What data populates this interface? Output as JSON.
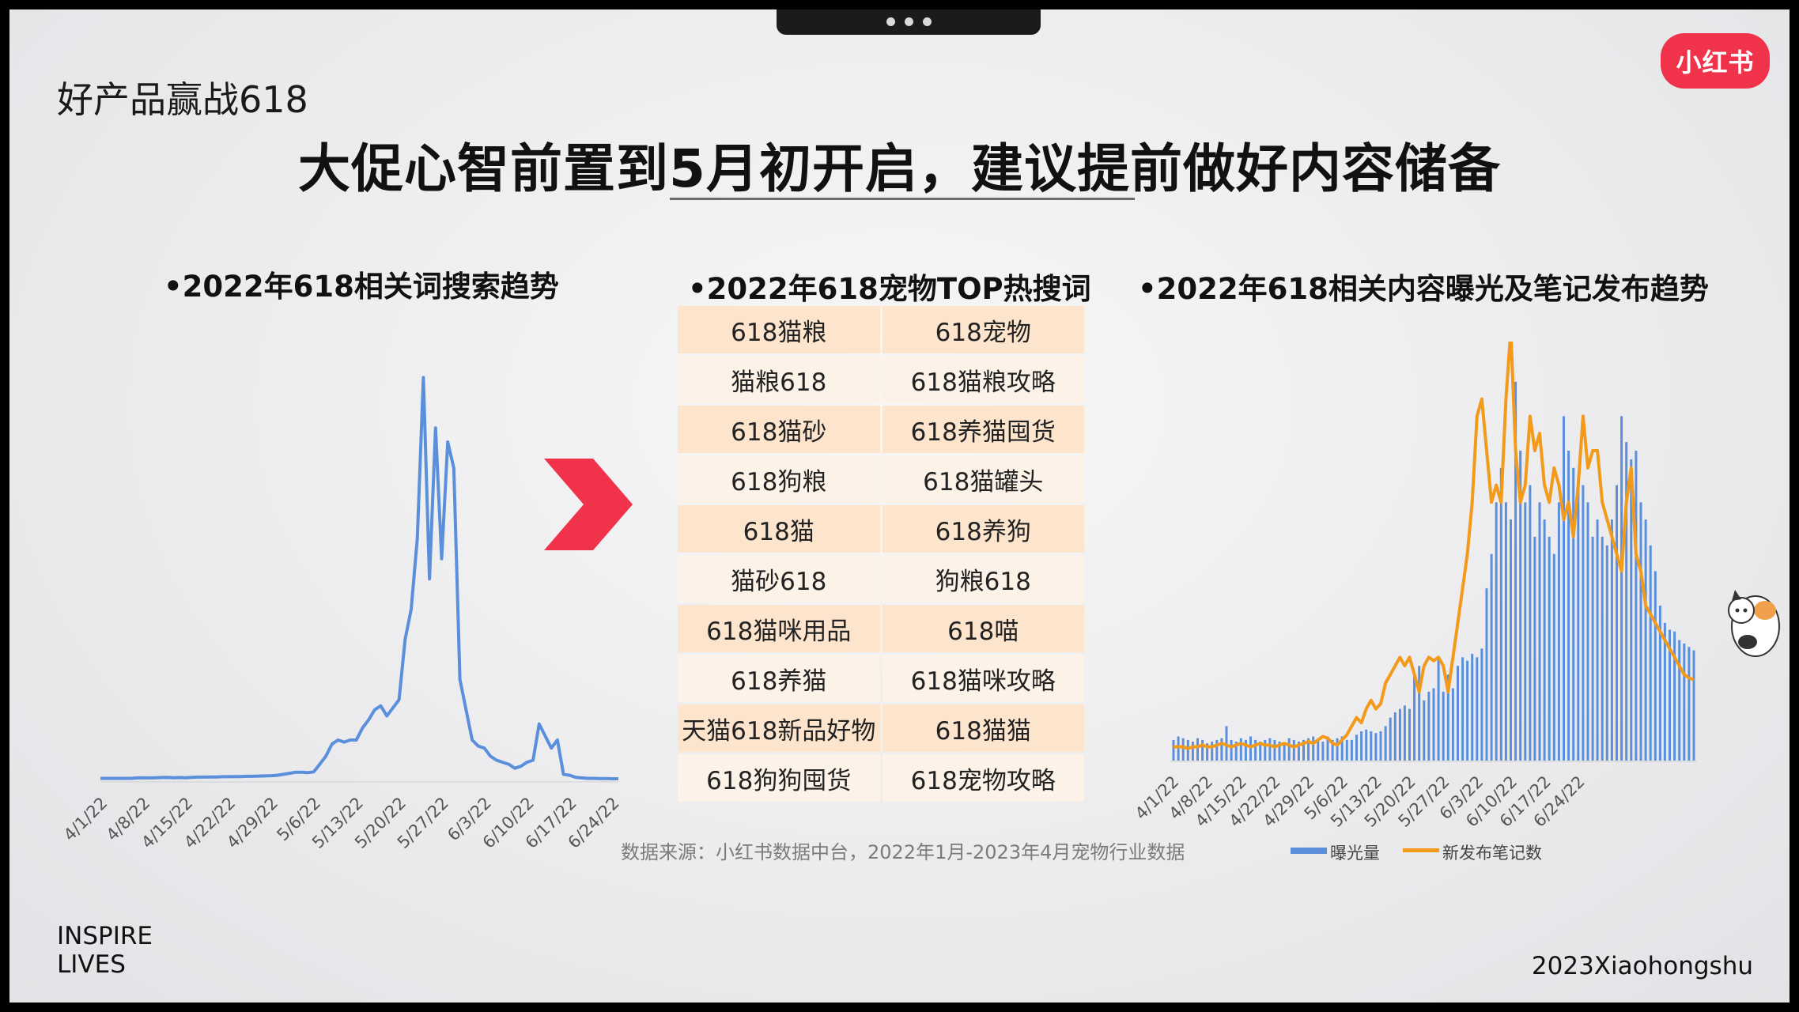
{
  "header": {
    "subtitle": "好产品赢战618",
    "title": "大促心智前置到5月初开启，建议提前做好内容储备",
    "logo": "小红书"
  },
  "sections": {
    "left_title": "•2022年618相关词搜索趋势",
    "mid_title": "•2022年618宠物TOP热搜词",
    "right_title": "•2022年618相关内容曝光及笔记发布趋势"
  },
  "keywords": [
    [
      "618猫粮",
      "618宠物"
    ],
    [
      "猫粮618",
      "618猫粮攻略"
    ],
    [
      "618猫砂",
      "618养猫囤货"
    ],
    [
      "618狗粮",
      "618猫罐头"
    ],
    [
      "618猫",
      "618养狗"
    ],
    [
      "猫砂618",
      "狗粮618"
    ],
    [
      "618猫咪用品",
      "618喵"
    ],
    [
      "618养猫",
      "618猫咪攻略"
    ],
    [
      "天猫618新品好物",
      "618猫猫"
    ],
    [
      "618狗狗囤货",
      "618宠物攻略"
    ]
  ],
  "source": "数据来源：小红书数据中台，2022年1月-2023年4月宠物行业数据",
  "footer": {
    "left_line1": "INSPIRE",
    "left_line2": "LIVES",
    "right": "2023Xiaohongshu"
  },
  "colors": {
    "brand": "#f0334b",
    "search_line": "#5b8fdc",
    "exposure_bar": "#5b8fdc",
    "notes_line": "#f39a1a",
    "table_odd": "#fde4cc",
    "table_even": "#fdf2e7"
  },
  "chart_data": [
    {
      "type": "line",
      "title": "•2022年618相关词搜索趋势",
      "x_ticks": [
        "4/1/22",
        "4/8/22",
        "4/15/22",
        "4/22/22",
        "4/29/22",
        "5/6/22",
        "5/13/22",
        "5/20/22",
        "5/27/22",
        "6/3/22",
        "6/10/22",
        "6/17/22",
        "6/24/22"
      ],
      "x_start": "2022-04-01",
      "series": [
        {
          "values": [
            1,
            1,
            1,
            1,
            1,
            1,
            1.2,
            1.3,
            1.2,
            1.3,
            1.4,
            1.5,
            1.3,
            1.4,
            1.3,
            1.5,
            1.6,
            1.6,
            1.7,
            1.7,
            1.8,
            1.8,
            1.9,
            1.9,
            2,
            2,
            2.1,
            2.2,
            2.3,
            2.5,
            3,
            3.5,
            4,
            4,
            3.8,
            4.2,
            8,
            12,
            18,
            20,
            19,
            20,
            20,
            26,
            30,
            35,
            37,
            32,
            36,
            40,
            70,
            85,
            120,
            200,
            100,
            175,
            110,
            168,
            155,
            50,
            35,
            20,
            17,
            16,
            12,
            10,
            9,
            8,
            6,
            7,
            9,
            10,
            28,
            22,
            16,
            20,
            3,
            2.5,
            1.5,
            1.2,
            1,
            1,
            0.9,
            0.9,
            0.8,
            0.8
          ],
          "color": "#5b8fdc"
        }
      ],
      "ylim": [
        0,
        210
      ]
    },
    {
      "type": "bar+line",
      "title": "•2022年618相关内容曝光及笔记发布趋势",
      "x_ticks": [
        "4/1/22",
        "4/8/22",
        "4/15/22",
        "4/22/22",
        "4/29/22",
        "5/6/22",
        "5/13/22",
        "5/20/22",
        "5/27/22",
        "6/3/22",
        "6/10/22",
        "6/17/22",
        "6/24/22"
      ],
      "x_start": "2022-04-01",
      "series": [
        {
          "name": "曝光量",
          "type": "bar",
          "color": "#5b8fdc",
          "values": [
            12,
            14,
            13,
            12,
            11,
            13,
            12,
            10,
            11,
            12,
            13,
            20,
            12,
            11,
            13,
            12,
            14,
            12,
            11,
            12,
            13,
            12,
            11,
            10,
            13,
            12,
            11,
            12,
            13,
            14,
            12,
            11,
            14,
            12,
            13,
            14,
            12,
            12,
            15,
            17,
            18,
            17,
            16,
            17,
            20,
            25,
            28,
            30,
            32,
            30,
            50,
            55,
            35,
            40,
            42,
            60,
            40,
            50,
            42,
            55,
            60,
            58,
            62,
            60,
            65,
            100,
            120,
            150,
            170,
            150,
            140,
            220,
            180,
            150,
            160,
            130,
            150,
            140,
            130,
            120,
            150,
            200,
            180,
            170,
            165,
            160,
            150,
            130,
            140,
            130,
            125,
            140,
            160,
            200,
            185,
            175,
            180,
            150,
            140,
            125,
            110,
            90,
            80,
            76,
            75,
            70,
            68,
            66,
            64
          ]
        },
        {
          "name": "新发布笔记数",
          "type": "line",
          "color": "#f39a1a",
          "values": [
            8,
            8,
            8,
            7,
            8,
            8,
            9,
            8,
            8,
            9,
            10,
            9,
            8,
            9,
            10,
            9,
            8,
            9,
            10,
            9,
            9,
            8,
            9,
            10,
            9,
            8,
            9,
            10,
            11,
            10,
            12,
            14,
            13,
            10,
            9,
            12,
            15,
            20,
            25,
            22,
            30,
            35,
            30,
            33,
            45,
            50,
            55,
            60,
            55,
            60,
            50,
            40,
            55,
            60,
            58,
            60,
            55,
            40,
            60,
            80,
            100,
            120,
            150,
            200,
            210,
            180,
            150,
            160,
            150,
            210,
            250,
            180,
            150,
            160,
            200,
            180,
            190,
            160,
            150,
            170,
            160,
            140,
            150,
            130,
            160,
            200,
            170,
            180,
            180,
            150,
            140,
            130,
            120,
            110,
            150,
            170,
            120,
            110,
            90,
            85,
            80,
            75,
            70,
            65,
            60,
            55,
            50,
            48,
            47
          ],
          "note": "line sampled across same x range"
        }
      ]
    }
  ]
}
